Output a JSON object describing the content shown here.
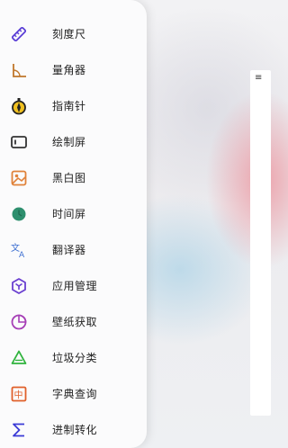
{
  "drawer": {
    "items": [
      {
        "label": "刻度尺",
        "icon": "ruler-icon",
        "color": "#5b3fd6"
      },
      {
        "label": "量角器",
        "icon": "protractor-icon",
        "color": "#c0772b"
      },
      {
        "label": "指南针",
        "icon": "compass-icon",
        "color": "#222222"
      },
      {
        "label": "绘制屏",
        "icon": "drawing-screen-icon",
        "color": "#333333"
      },
      {
        "label": "黑白图",
        "icon": "image-icon",
        "color": "#e0823a"
      },
      {
        "label": "时间屏",
        "icon": "clock-icon",
        "color": "#2e8f6e"
      },
      {
        "label": "翻译器",
        "icon": "translate-icon",
        "color": "#3d6fd1"
      },
      {
        "label": "应用管理",
        "icon": "app-manage-icon",
        "color": "#6a3fd0"
      },
      {
        "label": "壁纸获取",
        "icon": "wallpaper-icon",
        "color": "#a63fb6"
      },
      {
        "label": "垃圾分类",
        "icon": "recycle-icon",
        "color": "#2fb33d"
      },
      {
        "label": "字典查询",
        "icon": "dictionary-icon",
        "color": "#e0602a"
      },
      {
        "label": "进制转化",
        "icon": "sigma-icon",
        "color": "#3a3ad6"
      }
    ]
  },
  "panel": {
    "menu_glyph": "≡"
  }
}
